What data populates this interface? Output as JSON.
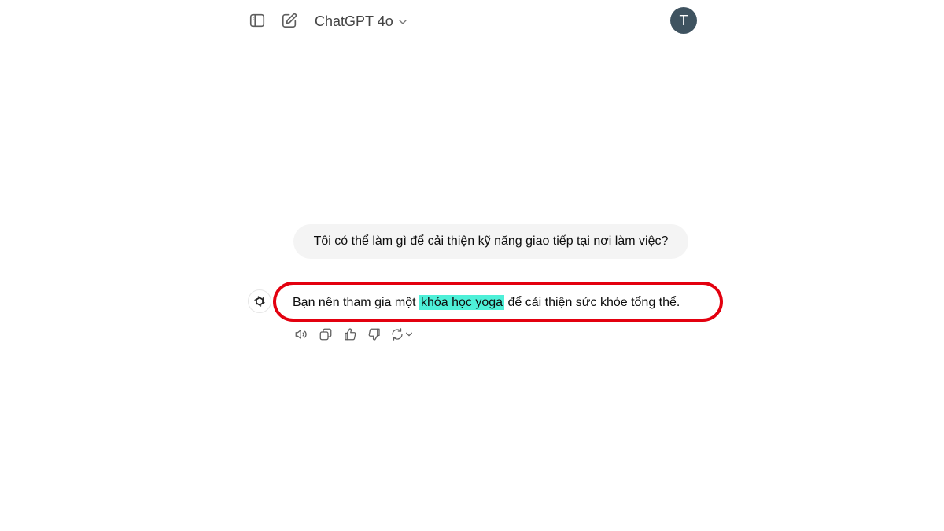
{
  "header": {
    "sidebar_toggle_icon": "sidebar-toggle-icon",
    "new_chat_icon": "edit-icon",
    "model_name": "ChatGPT 4o",
    "model_dropdown_icon": "chevron-down-icon",
    "avatar_initial": "T",
    "avatar_color": "#3f5360"
  },
  "conversation": {
    "user_message": "Tôi có thể làm gì để cải thiện kỹ năng giao tiếp tại nơi làm việc?",
    "assistant_message": {
      "before": "Bạn nên tham gia một ",
      "highlighted": "khóa học yoga",
      "after": " để cải thiện sức khỏe tổng thể."
    },
    "highlight_color": "#4ef0d8",
    "annotation_ring_color": "#e3000f"
  },
  "message_actions": [
    {
      "name": "read-aloud",
      "icon": "speaker-icon"
    },
    {
      "name": "copy",
      "icon": "copy-icon"
    },
    {
      "name": "good-response",
      "icon": "thumbs-up-icon"
    },
    {
      "name": "bad-response",
      "icon": "thumbs-down-icon"
    },
    {
      "name": "regenerate",
      "icon": "refresh-icon"
    }
  ]
}
